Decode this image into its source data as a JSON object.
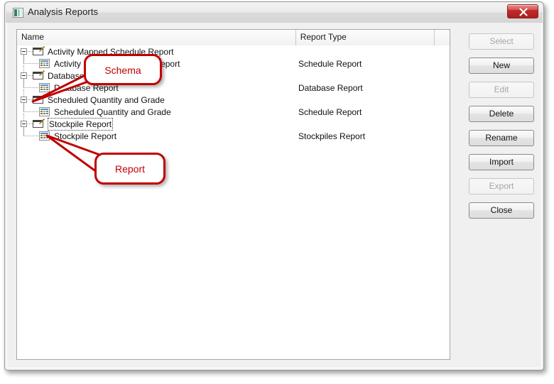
{
  "window": {
    "title": "Analysis Reports",
    "title_icon": "application-icon",
    "close_label": "x"
  },
  "list": {
    "columns": [
      {
        "key": "name",
        "label": "Name"
      },
      {
        "key": "type",
        "label": "Report Type"
      },
      {
        "key": "filler",
        "label": ""
      }
    ],
    "rows": [
      {
        "level": 0,
        "icon": "schema-icon",
        "name": "Activity Mapped Schedule Report",
        "type": "",
        "focused": false
      },
      {
        "level": 1,
        "icon": "report-icon",
        "name": "Activity Mapped Schedule Report",
        "type": "Schedule Report",
        "focused": false
      },
      {
        "level": 0,
        "icon": "schema-icon",
        "name": "Database Report",
        "type": "",
        "focused": false
      },
      {
        "level": 1,
        "icon": "report-icon",
        "name": "Database Report",
        "type": "Database Report",
        "focused": false
      },
      {
        "level": 0,
        "icon": "schema-icon",
        "name": "Scheduled Quantity and Grade",
        "type": "",
        "focused": false
      },
      {
        "level": 1,
        "icon": "report-icon",
        "name": "Scheduled Quantity and Grade",
        "type": "Schedule Report",
        "focused": false
      },
      {
        "level": 0,
        "icon": "schema-icon",
        "name": "Stockpile Report",
        "type": "",
        "focused": true
      },
      {
        "level": 1,
        "icon": "report-icon",
        "name": "Stockpile Report",
        "type": "Stockpiles Report",
        "focused": false
      }
    ]
  },
  "buttons": [
    {
      "label": "Select",
      "enabled": false
    },
    {
      "label": "New",
      "enabled": true
    },
    {
      "label": "Edit",
      "enabled": false
    },
    {
      "label": "Delete",
      "enabled": true
    },
    {
      "label": "Rename",
      "enabled": true
    },
    {
      "label": "Import",
      "enabled": true
    },
    {
      "label": "Export",
      "enabled": false
    },
    {
      "label": "Close",
      "enabled": true
    }
  ],
  "annotations": [
    {
      "id": "schema",
      "label": "Schema",
      "color": "#c00000"
    },
    {
      "id": "report",
      "label": "Report",
      "color": "#c00000"
    }
  ]
}
